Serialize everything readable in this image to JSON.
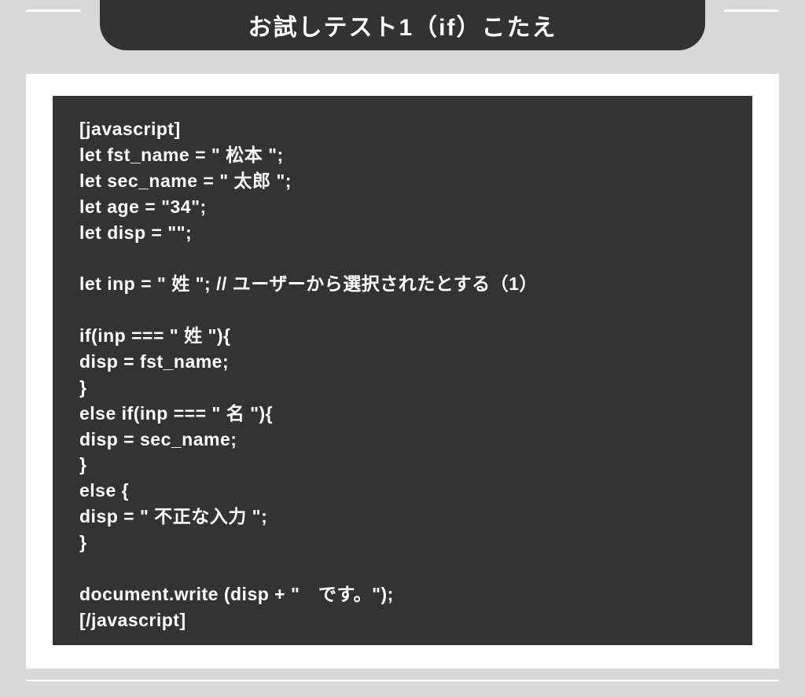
{
  "title": "お試しテスト1（if）こたえ",
  "code_lines": [
    "[javascript]",
    "let fst_name = \" 松本 \";",
    "let sec_name = \" 太郎 \";",
    "let age = \"34\";",
    "let disp = \"\";",
    "",
    "let inp = \" 姓 \"; // ユーザーから選択されたとする（1）",
    "",
    "if(inp === \" 姓 \"){",
    "disp = fst_name;",
    "}",
    "else if(inp === \" 名 \"){",
    "disp = sec_name;",
    "}",
    "else {",
    "disp = \" 不正な入力 \";",
    "}",
    "",
    "document.write (disp + \"　です。\");",
    "[/javascript]"
  ]
}
